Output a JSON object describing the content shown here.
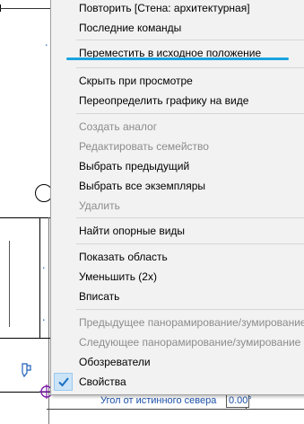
{
  "menu": {
    "items": [
      {
        "label": "Повторить [Стена: архитектурная]",
        "enabled": true
      },
      {
        "label": "Последние команды",
        "enabled": true
      },
      {
        "label": "Переместить в исходное положение",
        "enabled": true,
        "highlighted": true
      },
      {
        "label": "Скрыть при просмотре",
        "enabled": true
      },
      {
        "label": "Переопределить графику на виде",
        "enabled": true
      },
      {
        "label": "Создать аналог",
        "enabled": false
      },
      {
        "label": "Редактировать семейство",
        "enabled": false
      },
      {
        "label": "Выбрать предыдущий",
        "enabled": true
      },
      {
        "label": "Выбрать все экземпляры",
        "enabled": true
      },
      {
        "label": "Удалить",
        "enabled": false
      },
      {
        "label": "Найти опорные виды",
        "enabled": true
      },
      {
        "label": "Показать область",
        "enabled": true
      },
      {
        "label": "Уменьшить (2x)",
        "enabled": true
      },
      {
        "label": "Вписать",
        "enabled": true
      },
      {
        "label": "Предыдущее панорамирование/зумирование",
        "enabled": false
      },
      {
        "label": "Следующее панорамирование/зумирование",
        "enabled": false
      },
      {
        "label": "Обозреватели",
        "enabled": true
      },
      {
        "label": "Свойства",
        "enabled": true,
        "checked": true
      }
    ],
    "highlight_color": "#1aa3e0",
    "disabled_color": "#8c8c8c"
  },
  "canvas": {
    "angle_label": "Угол от истинного севера",
    "angle_value": "0.00°",
    "label_color": "#1b4fa8"
  }
}
